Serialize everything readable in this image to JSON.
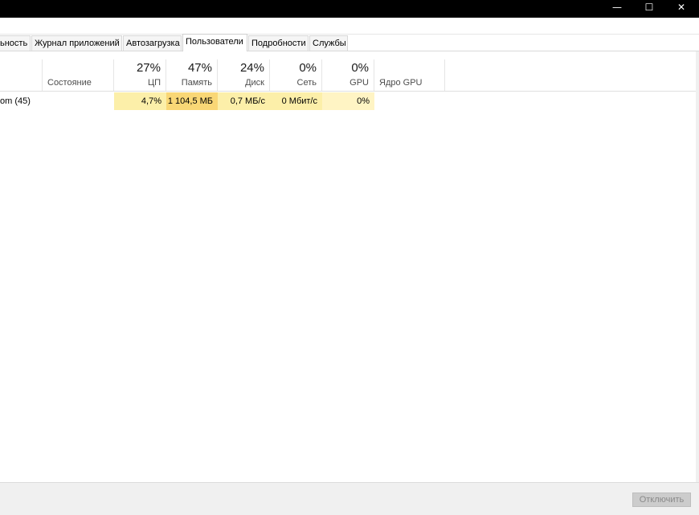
{
  "window": {
    "minimize_glyph": "—",
    "maximize_glyph": "☐",
    "close_glyph": "✕"
  },
  "tabs": [
    {
      "label": "ьность"
    },
    {
      "label": "Журнал приложений"
    },
    {
      "label": "Автозагрузка"
    },
    {
      "label": "Пользователи"
    },
    {
      "label": "Подробности"
    },
    {
      "label": "Службы"
    }
  ],
  "columns": {
    "status": {
      "label": "Состояние"
    },
    "cpu": {
      "pct": "27%",
      "label": "ЦП"
    },
    "memory": {
      "pct": "47%",
      "label": "Память"
    },
    "disk": {
      "pct": "24%",
      "label": "Диск"
    },
    "network": {
      "pct": "0%",
      "label": "Сеть"
    },
    "gpu": {
      "pct": "0%",
      "label": "GPU"
    },
    "gpu_engine": {
      "label": "Ядро GPU"
    }
  },
  "rows": [
    {
      "name": "om (45)",
      "cpu": "4,7%",
      "memory": "1 104,5 МБ",
      "disk": "0,7 МБ/с",
      "network": "0 Мбит/с",
      "gpu": "0%"
    }
  ],
  "footer": {
    "disconnect_label": "Отключить"
  },
  "colors": {
    "heat_light": "#fff4c4",
    "heat_mid": "#fce9a6",
    "heat_high": "#f9d878"
  }
}
